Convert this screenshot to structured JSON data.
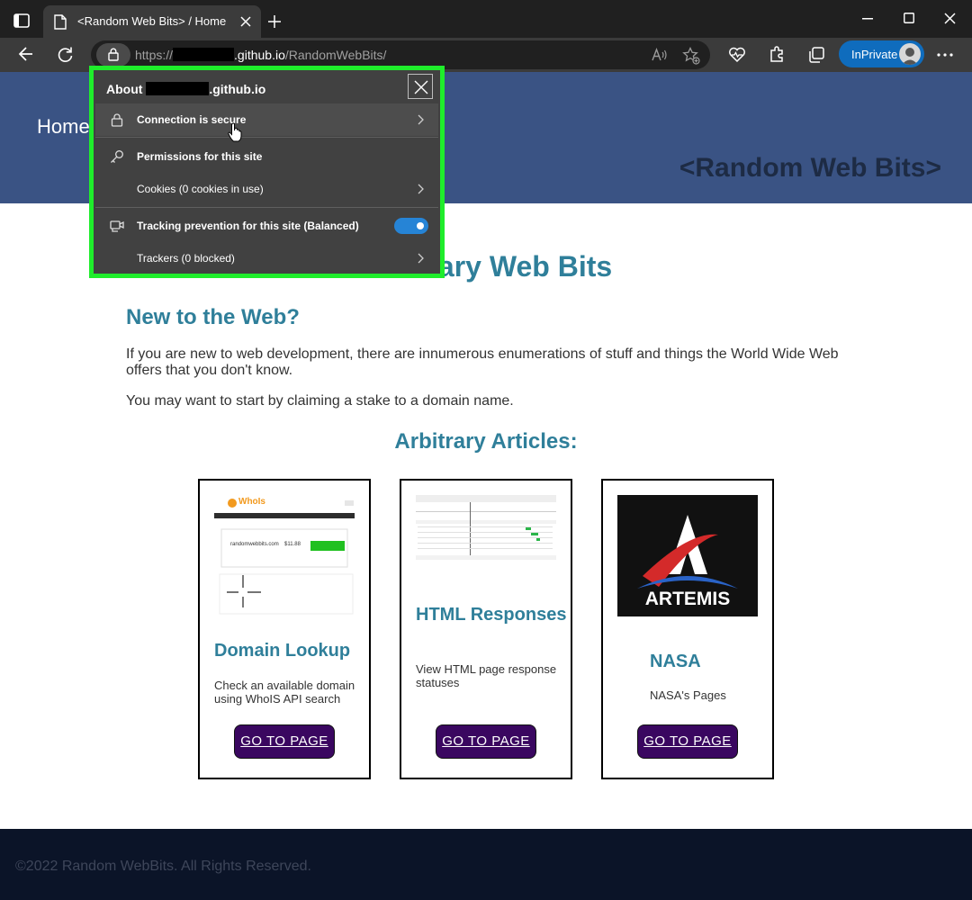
{
  "browser": {
    "tab_title": "<Random Web Bits> / Home",
    "url_prefix": "https://",
    "url_domain": ".github.io",
    "url_path": "/RandomWebBits/",
    "inprivate_label": "InPrivate"
  },
  "site_info": {
    "title_prefix": "About",
    "title_domain": ".github.io",
    "rows": {
      "connection": "Connection is secure",
      "permissions": "Permissions for this site",
      "cookies": "Cookies (0 cookies in use)",
      "tracking": "Tracking prevention for this site (Balanced)",
      "trackers": "Trackers (0 blocked)"
    },
    "tracking_enabled": true
  },
  "site": {
    "nav_home": "Home",
    "header_title": "<Random Web Bits>",
    "main_heading": "Arbitrary Web Bits",
    "new_heading": "New to the Web?",
    "intro1": "If you are new to web development, there are innumerous enumerations of stuff and things the World Wide Web offers that you don't know.",
    "intro2": "You may want to start by claiming a stake to a domain name.",
    "articles_heading": "Arbitrary Articles:",
    "cards": [
      {
        "title": "Domain Lookup",
        "desc": "Check an available domain using WhoIS API search",
        "button": "GO TO PAGE"
      },
      {
        "title": "HTML Responses",
        "desc": "View HTML page response statuses",
        "button": "GO TO PAGE"
      },
      {
        "title": "NASA",
        "desc": "NASA's Pages",
        "button": "GO TO PAGE"
      }
    ],
    "card_images": {
      "whois_brand": "WhoIs",
      "whois_domain": "randomwebbits.com",
      "whois_price": "$11.88",
      "artemis": "ARTEMIS"
    },
    "footer": "©2022 Random WebBits. All Rights Reserved."
  },
  "colors": {
    "header_bg": "#3a5384",
    "heading": "#2f7f9a",
    "button_bg": "#3a0760",
    "footer_bg": "#0b1428",
    "highlight_frame": "#1fed2b",
    "inprivate": "#0f6cbd"
  },
  "icons": {
    "tab": "page-icon",
    "lock": "lock-icon",
    "permissions": "key-icon",
    "tracking": "tracking-icon",
    "close": "close-icon"
  }
}
